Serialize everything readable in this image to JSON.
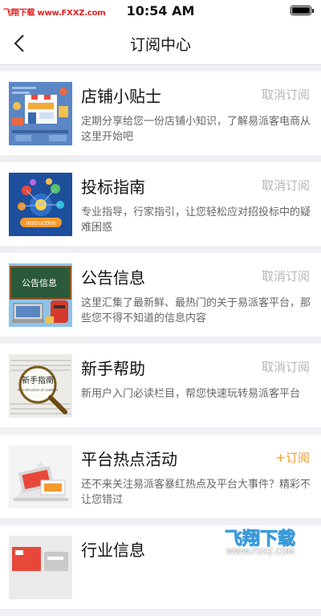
{
  "status_bar": {
    "watermark": "飞翔下载 www.FXXZ.com",
    "time": "10:54 AM"
  },
  "header": {
    "title": "订阅中心"
  },
  "items": [
    {
      "title": "店铺小贴士",
      "action": "取消订阅",
      "description": "定期分享给您一份店铺小知识，了解易派客电商从这里开始吧",
      "thumbnail_text": "Instruction",
      "subscribed": true
    },
    {
      "title": "投标指南",
      "action": "取消订阅",
      "description": "专业指导，行家指引，让您轻松应对招投标中的疑难困惑",
      "thumbnail_text": "Instruction",
      "subscribed": true
    },
    {
      "title": "公告信息",
      "action": "取消订阅",
      "description": "这里汇集了最新鲜、最热门的关于易派客平台，那些您不得不知道的信息内容",
      "thumbnail_text": "公告信息",
      "subscribed": true
    },
    {
      "title": "新手帮助",
      "action": "取消订阅",
      "description": "新用户入门必读栏目，帮您快速玩转易派客平台",
      "thumbnail_text": "新手指南",
      "thumbnail_subtext": "An instruction of newbies",
      "subscribed": true
    },
    {
      "title": "平台热点活动",
      "action": "+订阅",
      "description": "还不来关注易派客暴红热点及平台大事件？精彩不让您错过",
      "subscribed": false
    },
    {
      "title": "行业信息",
      "action": "",
      "description": "",
      "subscribed": false
    }
  ],
  "watermark_corner": {
    "text": "飞翔下载",
    "url": "WWW.FXXZ.COM"
  },
  "colors": {
    "accent_subscribe": "#f29a2e",
    "muted_action": "#b5b5b5",
    "background": "#efeff4",
    "watermark_red": "#e02020"
  }
}
